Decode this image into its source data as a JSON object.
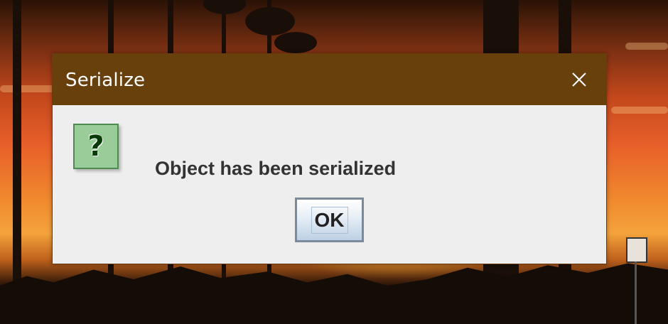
{
  "dialog": {
    "title": "Serialize",
    "message": "Object has been serialized",
    "ok_label": "OK",
    "icon": "question-icon",
    "close_icon": "close-icon"
  },
  "colors": {
    "titlebar": "#68400c",
    "dialog_body": "#eeeeee",
    "icon_bg": "#99cc99"
  }
}
